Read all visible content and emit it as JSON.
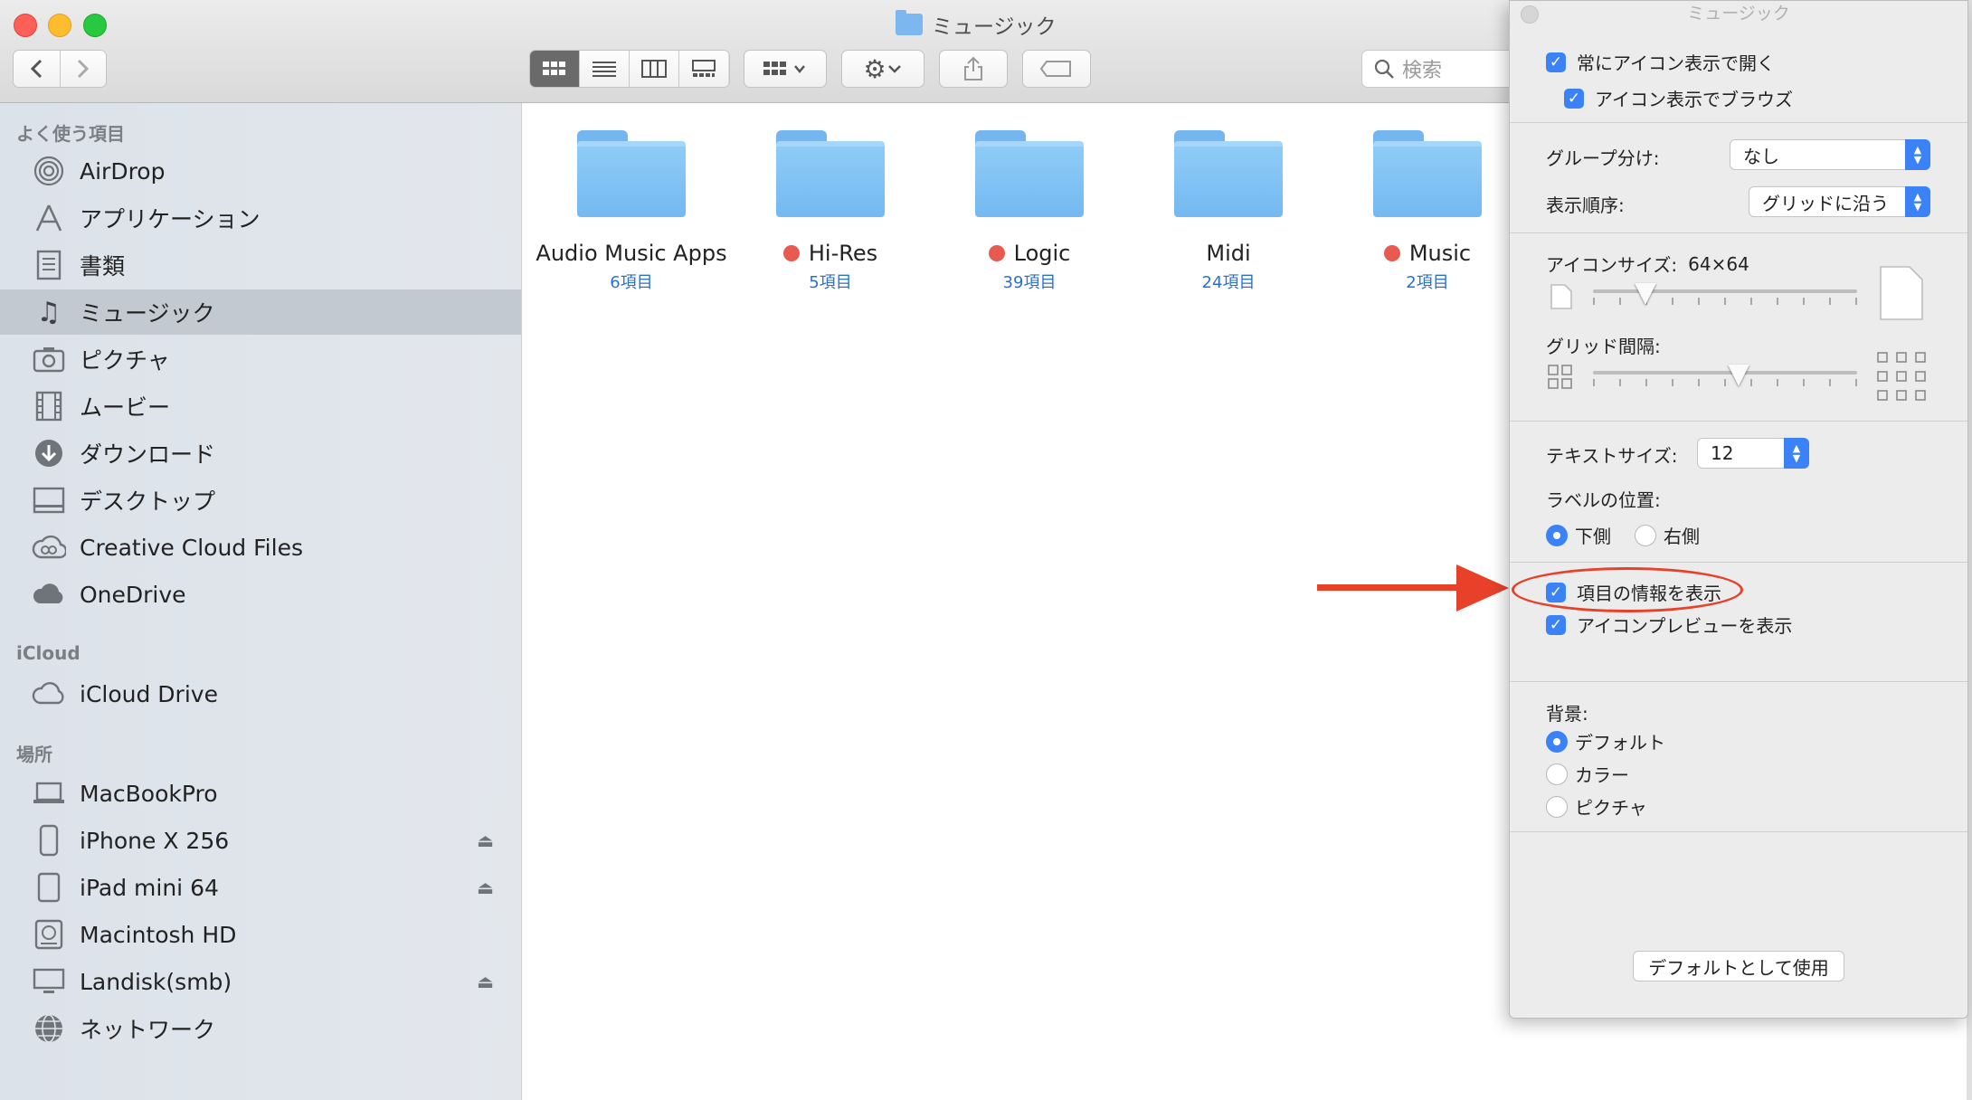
{
  "window": {
    "title": "ミュージック"
  },
  "toolbar": {
    "search_placeholder": "検索",
    "view_modes": [
      "icon",
      "list",
      "column",
      "gallery"
    ],
    "active_view": "icon"
  },
  "sidebar": {
    "sections": [
      {
        "title": "よく使う項目",
        "items": [
          {
            "label": "AirDrop",
            "icon": "airdrop-icon"
          },
          {
            "label": "アプリケーション",
            "icon": "applications-icon"
          },
          {
            "label": "書類",
            "icon": "documents-icon"
          },
          {
            "label": "ミュージック",
            "icon": "music-icon",
            "selected": true
          },
          {
            "label": "ピクチャ",
            "icon": "camera-icon"
          },
          {
            "label": "ムービー",
            "icon": "film-icon"
          },
          {
            "label": "ダウンロード",
            "icon": "download-icon"
          },
          {
            "label": "デスクトップ",
            "icon": "desktop-icon"
          },
          {
            "label": "Creative Cloud Files",
            "icon": "creative-cloud-icon"
          },
          {
            "label": "OneDrive",
            "icon": "cloud-icon"
          }
        ]
      },
      {
        "title": "iCloud",
        "items": [
          {
            "label": "iCloud Drive",
            "icon": "icloud-icon"
          }
        ]
      },
      {
        "title": "場所",
        "items": [
          {
            "label": "MacBookPro",
            "icon": "laptop-icon"
          },
          {
            "label": "iPhone X 256",
            "icon": "iphone-icon",
            "eject": true
          },
          {
            "label": "iPad mini 64",
            "icon": "ipad-icon",
            "eject": true
          },
          {
            "label": "Macintosh HD",
            "icon": "harddisk-icon"
          },
          {
            "label": "Landisk(smb)",
            "icon": "display-icon",
            "eject": true
          },
          {
            "label": "ネットワーク",
            "icon": "network-icon"
          }
        ]
      }
    ]
  },
  "folders": [
    {
      "name": "Audio Music Apps",
      "count": "6項目",
      "tag": null
    },
    {
      "name": "Hi-Res",
      "count": "5項目",
      "tag": "#e8594f"
    },
    {
      "name": "Logic",
      "count": "39項目",
      "tag": "#e8594f"
    },
    {
      "name": "Midi",
      "count": "24項目",
      "tag": null
    },
    {
      "name": "Music",
      "count": "2項目",
      "tag": "#e8594f"
    }
  ],
  "panel": {
    "title": "ミュージック",
    "always_icon_view": "常にアイコン表示で開く",
    "browse_icon_view": "アイコン表示でブラウズ",
    "group_by_label": "グループ分け:",
    "group_by_value": "なし",
    "sort_by_label": "表示順序:",
    "sort_by_value": "グリッドに沿う",
    "icon_size_label": "アイコンサイズ:",
    "icon_size_value": "64×64",
    "icon_size_level": 0.2,
    "grid_spacing_label": "グリッド間隔:",
    "grid_spacing_level": 0.55,
    "text_size_label": "テキストサイズ:",
    "text_size_value": "12",
    "label_position_label": "ラベルの位置:",
    "label_bottom": "下側",
    "label_right": "右側",
    "show_item_info": "項目の情報を表示",
    "show_icon_preview": "アイコンプレビューを表示",
    "background_label": "背景:",
    "bg_default": "デフォルト",
    "bg_color": "カラー",
    "bg_picture": "ピクチャ",
    "use_as_defaults": "デフォルトとして使用"
  },
  "colors": {
    "accent": "#3b82f7",
    "annotation": "#e8412a",
    "tag_red": "#e8594f"
  }
}
